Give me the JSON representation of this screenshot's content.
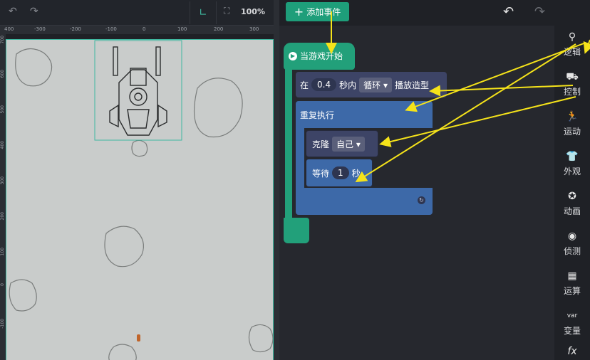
{
  "stage": {
    "zoom": "100%",
    "ruler_top": [
      "400",
      "-300",
      "-200",
      "-100",
      "0",
      "100",
      "200",
      "300"
    ],
    "ruler_left": [
      "700",
      "600",
      "500",
      "400",
      "300",
      "200",
      "100",
      "0",
      "-100"
    ]
  },
  "toolbar": {
    "add_event": "添加事件"
  },
  "blocks": {
    "hat": "当游戏开始",
    "play": {
      "prefix": "在",
      "seconds": "0.4",
      "mid": "秒内",
      "mode": "循环",
      "suffix": "播放造型"
    },
    "repeat": "重复执行",
    "clone": {
      "label": "克隆",
      "target": "自己"
    },
    "wait": {
      "label": "等待",
      "value": "1",
      "unit": "秒"
    }
  },
  "palette": [
    {
      "label": "逻辑",
      "icon": "logic-icon"
    },
    {
      "label": "控制",
      "icon": "control-icon"
    },
    {
      "label": "运动",
      "icon": "motion-icon"
    },
    {
      "label": "外观",
      "icon": "looks-icon"
    },
    {
      "label": "动画",
      "icon": "animation-icon"
    },
    {
      "label": "侦测",
      "icon": "sensing-icon"
    },
    {
      "label": "运算",
      "icon": "operators-icon"
    },
    {
      "label": "变量",
      "icon": "variables-icon"
    },
    {
      "label": "fx",
      "icon": "function-icon"
    }
  ]
}
